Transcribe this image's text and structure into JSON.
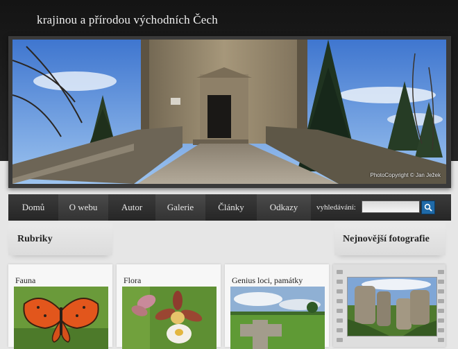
{
  "site": {
    "title": "krajinou a přírodou východních Čech",
    "photo_credit": "PhotoCopyright © Jan Ježek"
  },
  "nav": {
    "items": [
      {
        "label": "Domů"
      },
      {
        "label": "O webu"
      },
      {
        "label": "Autor"
      },
      {
        "label": "Galerie"
      },
      {
        "label": "Články"
      },
      {
        "label": "Odkazy"
      }
    ],
    "search_label": "vyhledávání:",
    "search_value": ""
  },
  "sections": {
    "rubriky": "Rubriky",
    "latest": "Nejnovější fotografie"
  },
  "cards": [
    {
      "title": "Fauna"
    },
    {
      "title": "Flora"
    },
    {
      "title": "Genius loci, památky"
    }
  ],
  "colors": {
    "header": "#1c1c1c",
    "nav": "#303030",
    "search_button": "#1f6aa8",
    "page_bg": "#e6e6e6"
  },
  "icons": {
    "search": "magnifier-icon"
  }
}
